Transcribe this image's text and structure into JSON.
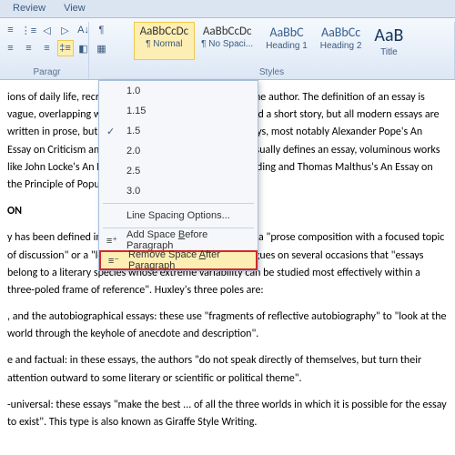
{
  "tabs": {
    "review": "Review",
    "view": "View"
  },
  "groups": {
    "paragraph": "Paragr",
    "styles": "Styles"
  },
  "styles": {
    "normal": {
      "preview": "AaBbCcDc",
      "label": "¶ Normal"
    },
    "nospacing": {
      "preview": "AaBbCcDc",
      "label": "¶ No Spaci..."
    },
    "heading1": {
      "preview": "AaBbC",
      "label": "Heading 1"
    },
    "heading2": {
      "preview": "AaBbCc",
      "label": "Heading 2"
    },
    "title": {
      "preview": "AaB",
      "label": "Title"
    }
  },
  "spacing_menu": {
    "v1": "1.0",
    "v115": "1.15",
    "v15": "1.5",
    "v2": "2.0",
    "v25": "2.5",
    "v3": "3.0",
    "options": "Line Spacing Options...",
    "add_before_pre": "Add Space ",
    "add_before_u": "B",
    "add_before_post": "efore Paragraph",
    "remove_after_pre": "Remove Space ",
    "remove_after_u": "A",
    "remove_after_post": "fter Paragraph"
  },
  "document": {
    "p1": "ions of daily life, recreated as a self-contained essay by the author. The definition of an essay is vague, overlapping with those of a prose composition and a short story, but all modern essays are written in prose, but some verse have been dubbed essays, most notably Alexander Pope's An Essay on Criticism and An Essay on Man. While brevity usually defines an essay, voluminous works like John Locke's An Essay Concerning Human Understanding and Thomas Malthus's An Essay on the Principle of Population are counterexamples.",
    "heading1": "ON",
    "p2": "y has been defined in a variety of ways. One definition is a \"prose composition with a focused topic of discussion\" or a \"long, systematic discourse Huxley argues on several occasions that \"essays belong to a literary species whose extreme variability can be studied most effectively within a three-poled frame of reference\". Huxley's three poles are:",
    "p3": ", and the autobiographical essays: these use \"fragments of reflective autobiography\" to \"look at the world through the keyhole of anecdote and description\".",
    "p4": "e and factual: in these essays, the authors \"do not speak directly of themselves, but turn their attention outward to some literary or scientific or political theme\".",
    "p5": "-universal: these essays \"make the best ... of all the three worlds in which it is possible for the essay to exist\". This type is also known as Giraffe Style Writing."
  }
}
